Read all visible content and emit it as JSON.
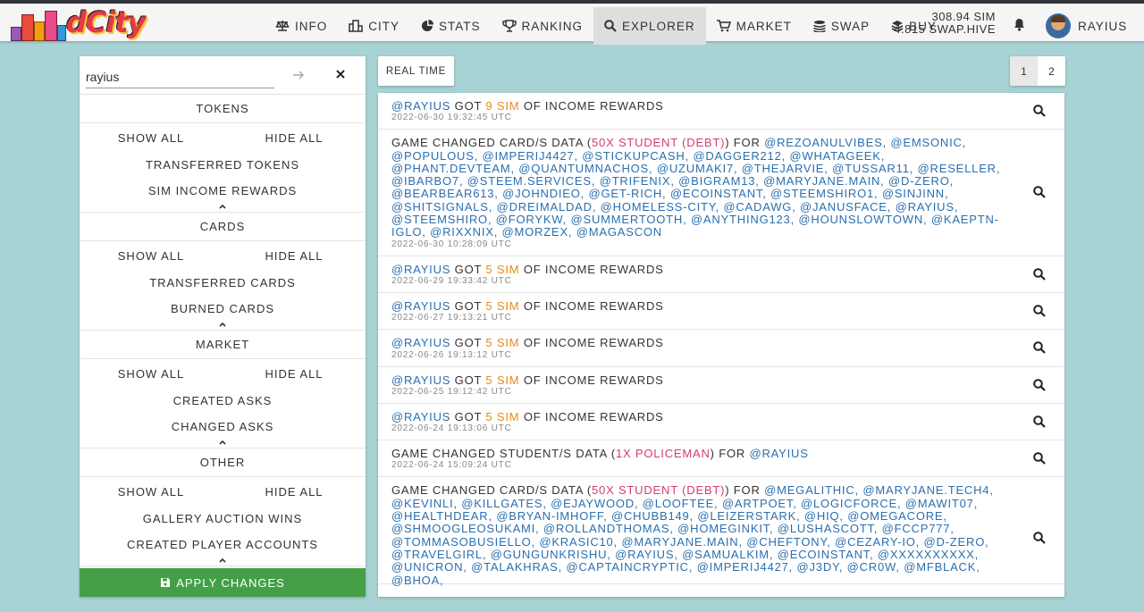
{
  "app": {
    "logo_text": "dCity"
  },
  "nav": {
    "items": [
      {
        "label": "INFO",
        "icon": "balance-scale-icon"
      },
      {
        "label": "CITY",
        "icon": "city-icon"
      },
      {
        "label": "STATS",
        "icon": "pie-chart-icon"
      },
      {
        "label": "RANKING",
        "icon": "trophy-icon"
      },
      {
        "label": "EXPLORER",
        "icon": "search-icon",
        "active": true
      },
      {
        "label": "MARKET",
        "icon": "cart-icon"
      },
      {
        "label": "SWAP",
        "icon": "coins-icon"
      },
      {
        "label": "BUY",
        "icon": "layers-icon"
      }
    ],
    "balance_sim": "308.94 SIM",
    "balance_swap": "4.815 SWAP.HIVE",
    "username": "RAYIUS"
  },
  "sidebar": {
    "search_value": "rayius",
    "show_all": "SHOW ALL",
    "hide_all": "HIDE ALL",
    "sections": [
      {
        "title": "TOKENS",
        "options": [
          "TRANSFERRED TOKENS",
          "SIM INCOME REWARDS"
        ]
      },
      {
        "title": "CARDS",
        "options": [
          "TRANSFERRED CARDS",
          "BURNED CARDS"
        ]
      },
      {
        "title": "MARKET",
        "options": [
          "CREATED ASKS",
          "CHANGED ASKS"
        ]
      },
      {
        "title": "OTHER",
        "options": [
          "GALLERY AUCTION WINS",
          "CREATED PLAYER ACCOUNTS"
        ]
      }
    ],
    "apply_label": "APPLY CHANGES"
  },
  "toolbar": {
    "realtime_label": "REAL TIME",
    "pages": [
      "1",
      "2"
    ],
    "active_page": "1"
  },
  "events": [
    {
      "user": "@RAYIUS",
      "got": "GOT",
      "amount": "9 SIM",
      "rest": "OF INCOME REWARDS",
      "ts": "2022-06-30 19:32:45 UTC"
    },
    {
      "prefix": "GAME CHANGED CARD/S DATA (",
      "highlight": "50x STUDENT (DEBT)",
      "suffix": ") FOR",
      "users": "@REZOANULVIBES, @EMSONIC, @POPULOUS, @IMPERIJ4427, @STICKUPCASH, @DAGGER212, @WHATAGEEK, @PHANT.DEVTEAM, @QUANTUMNACHOS, @UZUMAKI7, @THEJARVIE, @TUSSAR11, @RESELLER, @IBARBO7, @STEEM.SERVICES, @TRIFENIX, @BIGRAM13, @MARYJANE.MAIN, @D-ZERO, @BEARBEAR613, @JOHNDIEO, @GET-RICH, @ECOINSTANT, @STEEMSHIRO1, @SINJINN, @SHITSIGNALS, @DREIMALDAD, @HOMELESS-CITY, @CADAWG, @JANUSFACE, @RAYIUS, @STEEMSHIRO, @FORYKW, @SUMMERTOOTH, @ANYTHING123, @HOUNSLOWTOWN, @KAEPTN-IGLO, @RIXXNIX, @MORZEX, @MAGASCON",
      "ts": "2022-06-30 10:28:09 UTC"
    },
    {
      "user": "@RAYIUS",
      "got": "GOT",
      "amount": "5 SIM",
      "rest": "OF INCOME REWARDS",
      "ts": "2022-06-29 19:33:42 UTC"
    },
    {
      "user": "@RAYIUS",
      "got": "GOT",
      "amount": "5 SIM",
      "rest": "OF INCOME REWARDS",
      "ts": "2022-06-27 19:13:21 UTC"
    },
    {
      "user": "@RAYIUS",
      "got": "GOT",
      "amount": "5 SIM",
      "rest": "OF INCOME REWARDS",
      "ts": "2022-06-26 19:13:12 UTC"
    },
    {
      "user": "@RAYIUS",
      "got": "GOT",
      "amount": "5 SIM",
      "rest": "OF INCOME REWARDS",
      "ts": "2022-06-25 19:12:42 UTC"
    },
    {
      "user": "@RAYIUS",
      "got": "GOT",
      "amount": "5 SIM",
      "rest": "OF INCOME REWARDS",
      "ts": "2022-06-24 19:13:06 UTC"
    },
    {
      "prefix": "GAME CHANGED STUDENT/S DATA (",
      "highlight": "1x POLICEMAN",
      "suffix": ") FOR",
      "users": "@RAYIUS",
      "ts": "2022-06-24 15:09:24 UTC"
    },
    {
      "prefix": "GAME CHANGED CARD/S DATA (",
      "highlight": "50x STUDENT (DEBT)",
      "suffix": ") FOR",
      "users": "@MEGALITHIC, @MARYJANE.TECH4, @KEVINLI, @KILLGATES, @EJAYWOOD, @LOOFTEE, @ARTPOET, @LOGICFORCE, @MAWIT07, @HEALTHDEAR, @BRYAN-IMHOFF, @CHUBB149, @LEIZERSTARK, @HIQ, @OMEGACORE, @SHMOOGLEOSUKAMI, @ROLLANDTHOMAS, @HOMEGINKIT, @LUSHASCOTT, @FCCP777, @TOMMASOBUSIELLO, @KRASIC10, @MARYJANE.MAIN, @CHEFTONY, @CEZARY-IO, @D-ZERO, @TRAVELGIRL, @GUNGUNKRISHU, @RAYIUS, @SAMUALKIM, @ECOINSTANT, @XXXXXXXXXX, @UNICRON, @TALAKHRAS, @CAPTAINCRYPTIC, @IMPERIJ4427, @J3DY, @CR0W, @MFBLACK, @BHOA,",
      "ts": ""
    }
  ]
}
